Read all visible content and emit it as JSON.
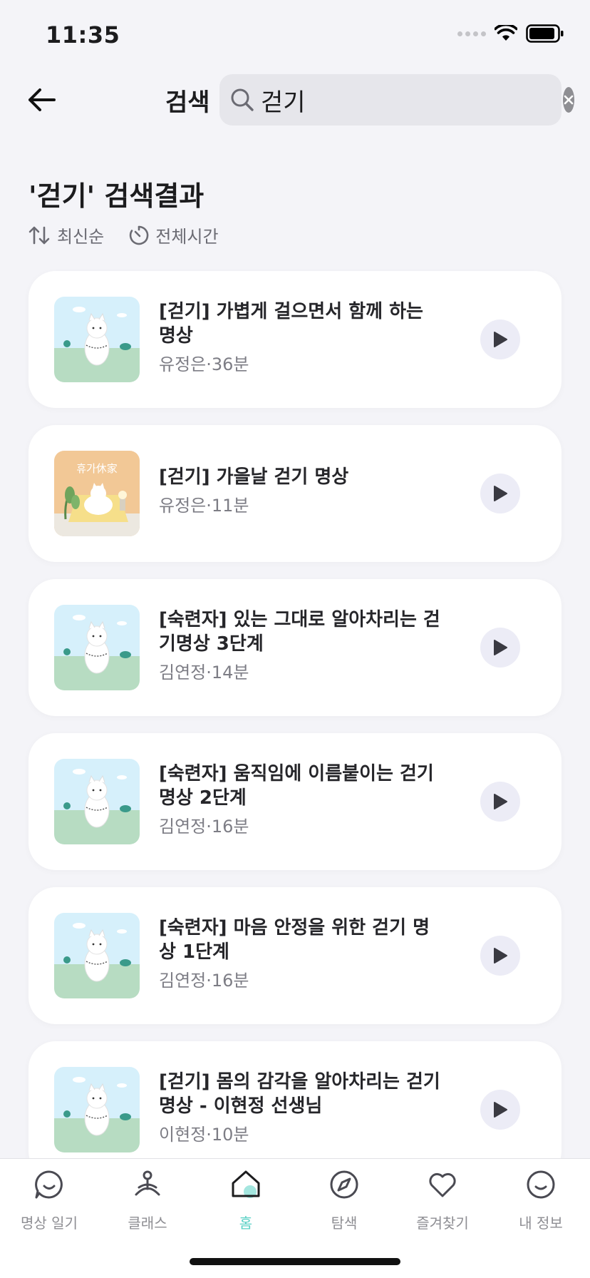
{
  "status_bar": {
    "time": "11:35"
  },
  "header": {
    "title": "검색",
    "search": {
      "value": "걷기",
      "placeholder": ""
    }
  },
  "results": {
    "title": "'걷기' 검색결과",
    "sort_label": "최신순",
    "duration_label": "전체시간",
    "items": [
      {
        "title": "[걷기] 가볍게 걸으면서 함께 하는 명상",
        "meta": "유정은·36분",
        "thumb": "cat-sky"
      },
      {
        "title": "[걷기] 가을날 걷기 명상",
        "meta": "유정은·11분",
        "thumb": "rest-house",
        "thumb_text": "휴가休家"
      },
      {
        "title": "[숙련자] 있는 그대로 알아차리는 걷기명상 3단계",
        "meta": "김연정·14분",
        "thumb": "cat-sky"
      },
      {
        "title": "[숙련자] 움직임에 이름붙이는 걷기 명상 2단계",
        "meta": "김연정·16분",
        "thumb": "cat-sky"
      },
      {
        "title": "[숙련자] 마음 안정을 위한 걷기 명상 1단계",
        "meta": "김연정·16분",
        "thumb": "cat-sky"
      },
      {
        "title": "[걷기] 몸의 감각을 알아차리는 걷기 명상 - 이현정 선생님",
        "meta": "이현정·10분",
        "thumb": "cat-sky"
      }
    ]
  },
  "tab_bar": {
    "tabs": [
      {
        "label": "명상 일기",
        "icon": "chat-smile-icon"
      },
      {
        "label": "클래스",
        "icon": "meditation-person-icon"
      },
      {
        "label": "홈",
        "icon": "home-icon",
        "active": true
      },
      {
        "label": "탐색",
        "icon": "compass-icon"
      },
      {
        "label": "즐겨찾기",
        "icon": "heart-icon"
      },
      {
        "label": "내 정보",
        "icon": "smile-icon"
      }
    ]
  },
  "colors": {
    "accent": "#5ad1c5",
    "background": "#f4f4f8",
    "card": "#ffffff",
    "play_bg": "#ececf6"
  }
}
